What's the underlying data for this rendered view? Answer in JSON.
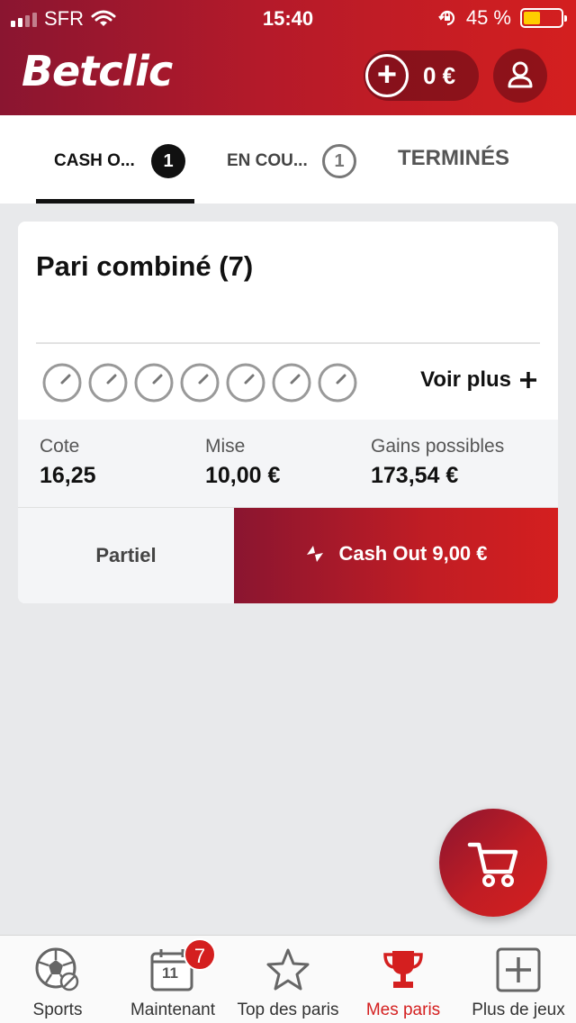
{
  "status_bar": {
    "carrier": "SFR",
    "time": "15:40",
    "battery": "45 %",
    "battery_level": 0.45,
    "battery_color": "#ffcc00"
  },
  "header": {
    "logo_text": "Betclic",
    "balance": "0 €",
    "brand_color": "#d41f1f"
  },
  "tabs": [
    {
      "label": "CASH O...",
      "count": "1",
      "active": true
    },
    {
      "label": "EN COU...",
      "count": "1",
      "active": false
    },
    {
      "label": "TERMINÉS",
      "active": false
    }
  ],
  "bet_card": {
    "title": "Pari combiné (7)",
    "event_icons": [
      "clock-icon",
      "clock-icon",
      "clock-icon",
      "clock-icon",
      "clock-icon",
      "clock-icon",
      "clock-icon"
    ],
    "voir_plus": "Voir plus",
    "stats": [
      {
        "label": "Cote",
        "value": "16,25"
      },
      {
        "label": "Mise",
        "value": "10,00 €"
      },
      {
        "label": "Gains possibles",
        "value": "173,54 €"
      }
    ],
    "partial_label": "Partiel",
    "cashout_label": "Cash Out 9,00 €"
  },
  "fab": {
    "icon": "cart-icon"
  },
  "bottom_nav": [
    {
      "label": "Sports",
      "icon": "soccer-ball-icon",
      "active": false
    },
    {
      "label": "Maintenant",
      "icon": "calendar-icon",
      "calendar_day": "11",
      "badge": "7",
      "active": false
    },
    {
      "label": "Top des paris",
      "icon": "star-icon",
      "active": false
    },
    {
      "label": "Mes paris",
      "icon": "trophy-icon",
      "active": true
    },
    {
      "label": "Plus de jeux",
      "icon": "plus-square-icon",
      "active": false
    }
  ]
}
